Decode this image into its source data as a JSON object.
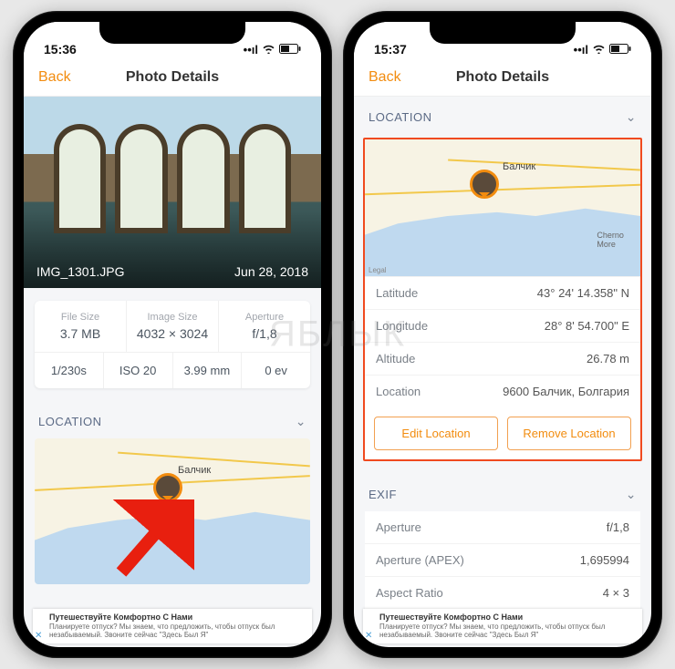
{
  "watermark": "ЯБЛЫК",
  "left": {
    "status": {
      "time": "15:36",
      "signal": "••ıl",
      "wifi": "⧋",
      "battery": "⬜"
    },
    "nav": {
      "back": "Back",
      "title": "Photo Details"
    },
    "hero": {
      "filename": "IMG_1301.JPG",
      "date": "Jun 28, 2018"
    },
    "info": {
      "fileSizeLabel": "File Size",
      "fileSize": "3.7 MB",
      "imageSizeLabel": "Image Size",
      "imageSize": "4032 × 3024",
      "apertureLabel": "Aperture",
      "aperture": "f/1,8",
      "shutter": "1/230s",
      "iso": "ISO 20",
      "focal": "3.99 mm",
      "ev": "0 ev"
    },
    "section": "LOCATION",
    "mapLabel": "Балчик",
    "ad": {
      "title": "Путешествуйте Комфортно С Нами",
      "text": "Планируете отпуск? Мы знаем, что предложить, чтобы отпуск был незабываемый. Звоните сейчас \"Здесь Был Я\""
    }
  },
  "right": {
    "status": {
      "time": "15:37",
      "signal": "••ıl",
      "wifi": "⧋",
      "battery": "⬜"
    },
    "nav": {
      "back": "Back",
      "title": "Photo Details"
    },
    "sectionLoc": "LOCATION",
    "mapLabel": "Балчик",
    "mapLabel2": "Cherno\nMore",
    "latLabel": "Latitude",
    "lat": "43° 24' 14.358\" N",
    "lonLabel": "Longitude",
    "lon": "28° 8' 54.700\" E",
    "altLabel": "Altitude",
    "alt": "26.78 m",
    "locLabel": "Location",
    "loc": "9600 Балчик, Болгария",
    "editBtn": "Edit Location",
    "removeBtn": "Remove Location",
    "sectionExif": "EXIF",
    "exif": {
      "apertureLabel": "Aperture",
      "aperture": "f/1,8",
      "apexLabel": "Aperture (APEX)",
      "apex": "1,695994",
      "arLabel": "Aspect Ratio",
      "ar": "4 × 3"
    },
    "ad": {
      "title": "Путешествуйте Комфортно С Нами",
      "text": "Планируете отпуск? Мы знаем, что предложить, чтобы отпуск был незабываемый. Звоните сейчас \"Здесь Был Я\""
    }
  }
}
